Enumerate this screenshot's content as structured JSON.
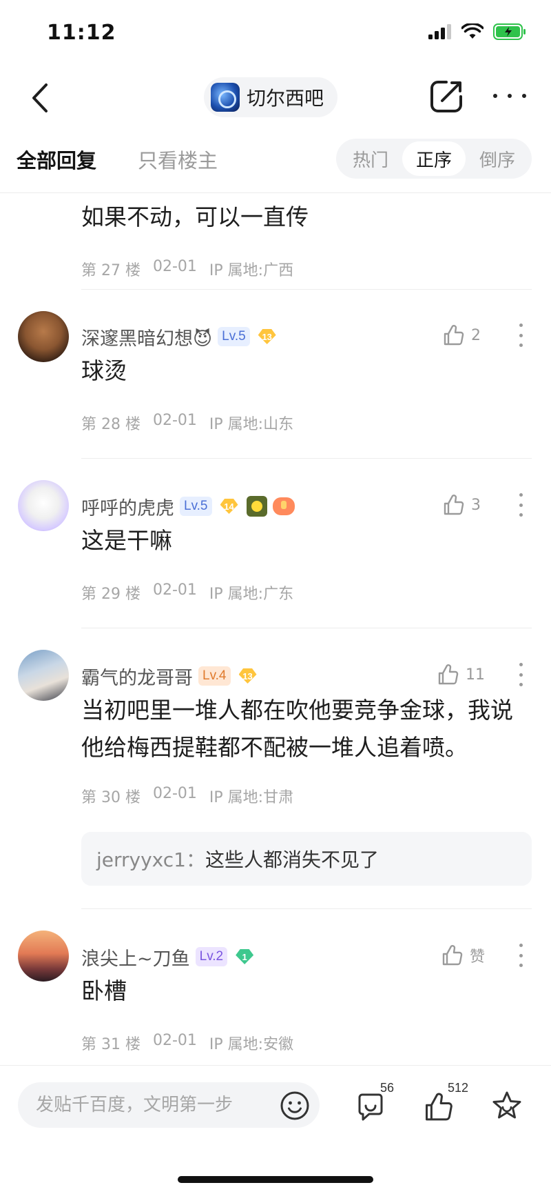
{
  "status_bar": {
    "time": "11:12"
  },
  "nav": {
    "forum_name": "切尔西吧"
  },
  "filters": {
    "all_replies": "全部回复",
    "owner_only": "只看楼主",
    "sort_hot": "热门",
    "sort_asc": "正序",
    "sort_desc": "倒序",
    "active_sort": "正序"
  },
  "partial_post": {
    "text": "如果不动，可以一直传",
    "floor": "第 27 楼",
    "date": "02-01",
    "ip": "IP 属地:广西"
  },
  "posts": [
    {
      "username": "深邃黑暗幻想😈",
      "level": "Lv.5",
      "badge": "13",
      "likes": "2",
      "text": "球烫",
      "floor": "第 28 楼",
      "date": "02-01",
      "ip": "IP 属地:山东"
    },
    {
      "username": "呼呼的虎虎",
      "level": "Lv.5",
      "badge": "14",
      "likes": "3",
      "text": "这是干嘛",
      "floor": "第 29 楼",
      "date": "02-01",
      "ip": "IP 属地:广东"
    },
    {
      "username": "霸气的龙哥哥",
      "level": "Lv.4",
      "badge": "13",
      "likes": "11",
      "text_line1": "当初吧里一堆人都在吹他要竞争金球，我说",
      "text_line2": "他给梅西提鞋都不配被一堆人追着喷。",
      "floor": "第 30 楼",
      "date": "02-01",
      "ip": "IP 属地:甘肃",
      "quote_user": "jerryyxc1：",
      "quote_text": "这些人都消失不见了"
    },
    {
      "username": "浪尖上~刀鱼",
      "level": "Lv.2",
      "badge": "1",
      "likes": "赞",
      "text": "卧槽",
      "floor": "第 31 楼",
      "date": "02-01",
      "ip": "IP 属地:安徽"
    }
  ],
  "bottom_bar": {
    "input_placeholder": "发贴千百度，文明第一步",
    "comment_count": "56",
    "like_count": "512"
  },
  "icons": {
    "back": "chevron-left-icon",
    "share": "share-edit-icon",
    "more": "more-horizontal-icon",
    "like": "thumb-up-icon",
    "kebab": "more-vertical-icon",
    "emoji": "smile-icon",
    "comment": "comment-icon",
    "star": "star-icon"
  },
  "colors": {
    "lv_blue": "#4a6fd6",
    "lv_orange": "#e07a2c",
    "lv_purple": "#7a55e0",
    "badge_gold": "#ffc53d",
    "badge_green": "#3ec88e",
    "battery_green": "#2fc24b"
  }
}
